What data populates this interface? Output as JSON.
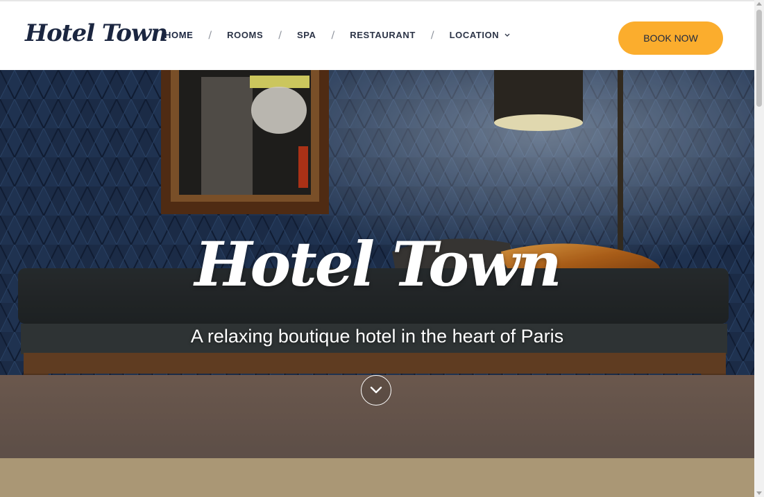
{
  "brand": {
    "logo_text": "Hotel Town"
  },
  "nav": {
    "items": [
      {
        "label": "HOME"
      },
      {
        "label": "ROOMS"
      },
      {
        "label": "SPA"
      },
      {
        "label": "RESTAURANT"
      },
      {
        "label": "LOCATION"
      }
    ],
    "separator": "/"
  },
  "header": {
    "book_label": "BOOK NOW"
  },
  "hero": {
    "title": "Hotel Town",
    "subtitle": "A relaxing boutique hotel in the heart of Paris",
    "scroll_icon": "chevron-down-icon"
  },
  "colors": {
    "accent": "#fbad2d",
    "navy": "#1b2640",
    "hero_wall": "#1d2c44"
  }
}
